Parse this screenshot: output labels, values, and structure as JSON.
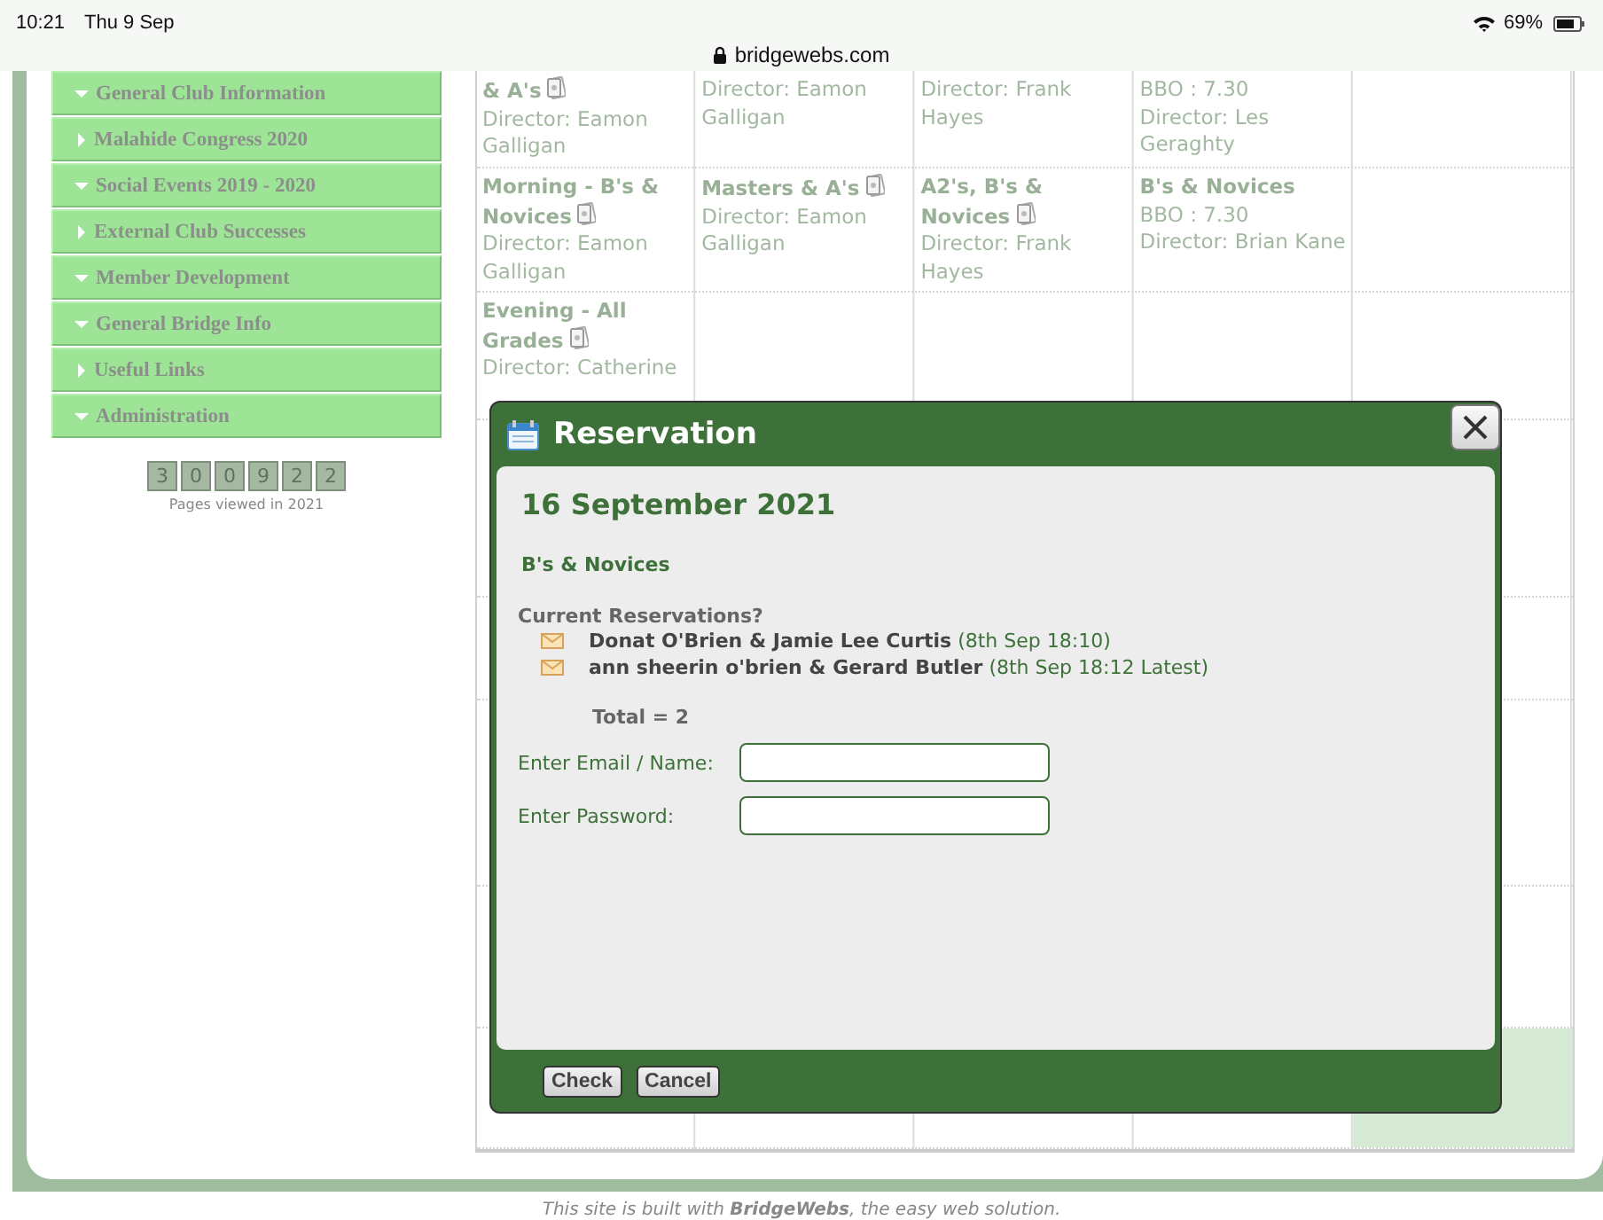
{
  "status_bar": {
    "time": "10:21",
    "date": "Thu 9 Sep",
    "url": "bridgewebs.com",
    "battery": "69%"
  },
  "sidebar": {
    "items": [
      {
        "label": "General Club Information",
        "expanded": true
      },
      {
        "label": "Malahide Congress 2020",
        "expanded": false
      },
      {
        "label": "Social Events 2019 - 2020",
        "expanded": true
      },
      {
        "label": "External Club Successes",
        "expanded": false
      },
      {
        "label": "Member Development",
        "expanded": true
      },
      {
        "label": "General Bridge Info",
        "expanded": true
      },
      {
        "label": "Useful Links",
        "expanded": false
      },
      {
        "label": "Administration",
        "expanded": true
      }
    ],
    "counter": {
      "digits": [
        "3",
        "0",
        "0",
        "9",
        "2",
        "2"
      ],
      "caption": "Pages viewed in 2021"
    }
  },
  "calendar": {
    "rows": [
      {
        "cells": [
          {
            "title": "& A's",
            "card_icon": true,
            "lines": [
              "Director: Eamon Galligan"
            ]
          },
          {
            "lines": [
              "Director: Eamon Galligan"
            ]
          },
          {
            "lines": [
              "Director: Frank Hayes"
            ]
          },
          {
            "lines": [
              "BBO : 7.30",
              "Director: Les Geraghty"
            ]
          },
          {}
        ]
      },
      {
        "cells": [
          {
            "title": "Morning - B's & Novices",
            "card_icon": true,
            "lines": [
              "Director: Eamon Galligan"
            ]
          },
          {
            "title": "Masters & A's",
            "card_icon": true,
            "lines": [
              "Director: Eamon Galligan"
            ]
          },
          {
            "title": "A2's, B's & Novices",
            "card_icon": true,
            "lines": [
              "Director: Frank Hayes"
            ]
          },
          {
            "title": "B's & Novices",
            "card_icon": false,
            "lines": [
              "BBO : 7.30",
              "Director: Brian Kane"
            ]
          },
          {}
        ]
      },
      {
        "cells": [
          {
            "title": "Evening - All Grades",
            "card_icon": true,
            "lines": [
              "Director: Catherine"
            ]
          },
          {},
          {},
          {},
          {}
        ]
      },
      {
        "cells": [
          {},
          {},
          {},
          {},
          {}
        ]
      },
      {
        "cells": [
          {},
          {},
          {},
          {},
          {}
        ]
      },
      {
        "cells": [
          {},
          {},
          {},
          {},
          {}
        ]
      },
      {
        "cells": [
          {},
          {},
          {},
          {},
          {}
        ]
      },
      {
        "cells": [
          {},
          {},
          {},
          {},
          {
            "highlighted": true
          }
        ]
      }
    ]
  },
  "dialog": {
    "title": "Reservation",
    "date": "16 September 2021",
    "event": "B's & Novices",
    "reservations_heading": "Current Reservations?",
    "reservations": [
      {
        "names": "Donat O'Brien & Jamie Lee Curtis",
        "time": "(8th Sep 18:10)"
      },
      {
        "names": "ann sheerin o'brien & Gerard Butler",
        "time": "(8th Sep 18:12 Latest)"
      }
    ],
    "total": "Total = 2",
    "fields": [
      {
        "label": "Enter Email / Name:"
      },
      {
        "label": "Enter Password:"
      }
    ],
    "buttons": [
      "Check",
      "Cancel"
    ]
  },
  "footer": "This site is built with **BridgeWebs**, the easy web solution."
}
